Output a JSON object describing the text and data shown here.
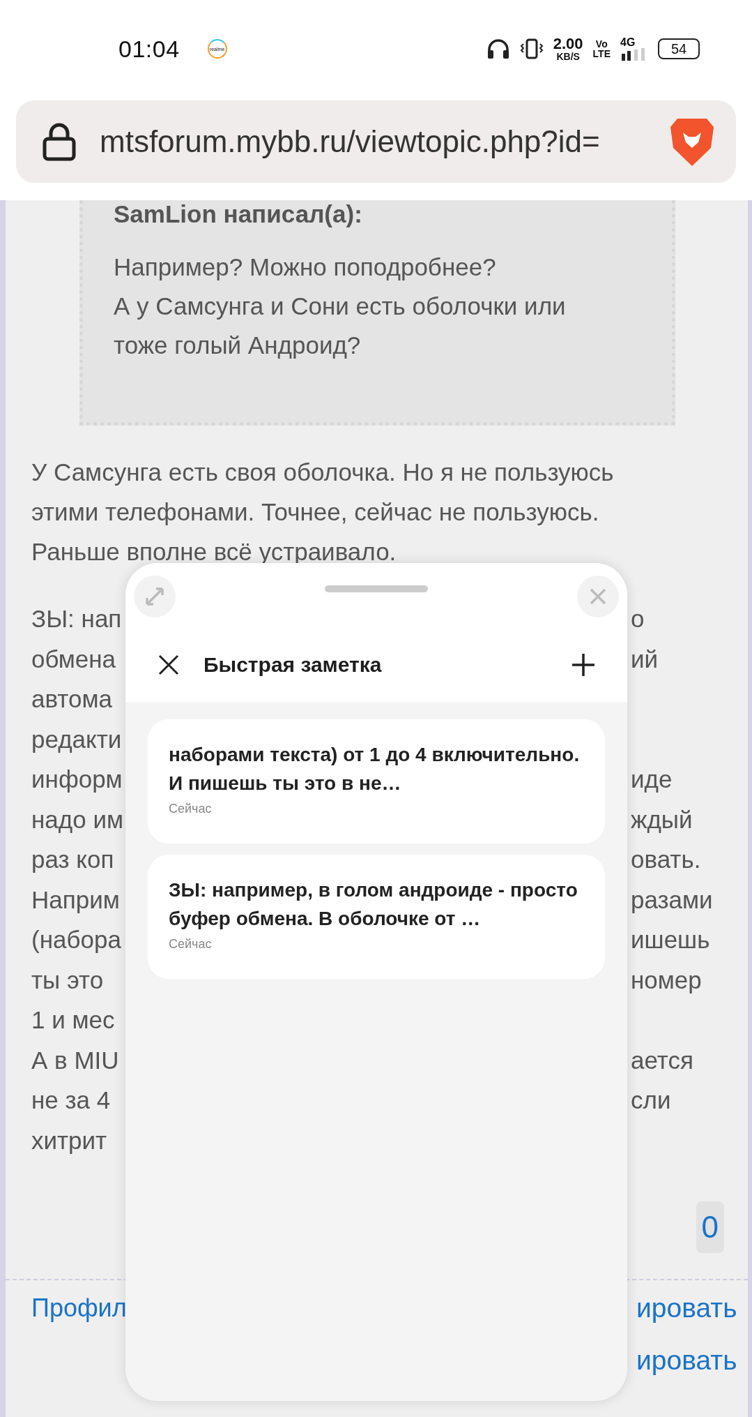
{
  "status_bar": {
    "time": "01:04",
    "app_logo": "realme",
    "network_speed": "2.00",
    "network_speed_unit": "KB/S",
    "volte_top": "Vo",
    "volte_bottom": "LTE",
    "network_type": "4G",
    "battery": "54"
  },
  "address_bar": {
    "url": "mtsforum.mybb.ru/viewtopic.php?id="
  },
  "post": {
    "quote": {
      "author": "SamLion написал(а):",
      "lines": [
        "Например? Можно поподробнее?",
        "А у Самсунга и Сони есть оболочки или",
        "тоже голый Андроид?"
      ]
    },
    "paragraph_lines": [
      "У Самсунга есть своя оболочка. Но я не пользуюсь",
      "этими телефонами. Точнее, сейчас не пользуюсь.",
      "Раньше вполне всё устраивало."
    ],
    "covered_lines": [
      {
        "left": "ЗЫ: нап",
        "right": "о"
      },
      {
        "left": "обмена",
        "right": "ий"
      },
      {
        "left": "автома"
      },
      {
        "left": "редакти"
      },
      {
        "left": "информ",
        "right": "иде"
      },
      {
        "left": "надо им",
        "right": "ждый"
      },
      {
        "left": "раз коп",
        "right": "овать."
      },
      {
        "left": "Наприм",
        "right": "разами"
      },
      {
        "left": "(набора",
        "right": "ишешь"
      },
      {
        "left": "ты это",
        "right": "номер"
      },
      {
        "left": "1 и мес"
      },
      {
        "left": "А в MIU",
        "right": "ается"
      },
      {
        "left": "не за 4",
        "right": "сли"
      },
      {
        "left": "хитрит"
      }
    ],
    "likes": "0",
    "footer_links": [
      {
        "left": "Профил",
        "right": "ировать"
      },
      {
        "right": "ировать"
      }
    ]
  },
  "quick_note": {
    "title": "Быстрая заметка",
    "notes": [
      {
        "text": "наборами текста) от 1 до 4 включительно. И пишешь ты это в не…",
        "time": "Сейчас"
      },
      {
        "text": "ЗЫ: например, в голом андроиде - просто буфер обмена. В оболочке от …",
        "time": "Сейчас"
      }
    ]
  }
}
